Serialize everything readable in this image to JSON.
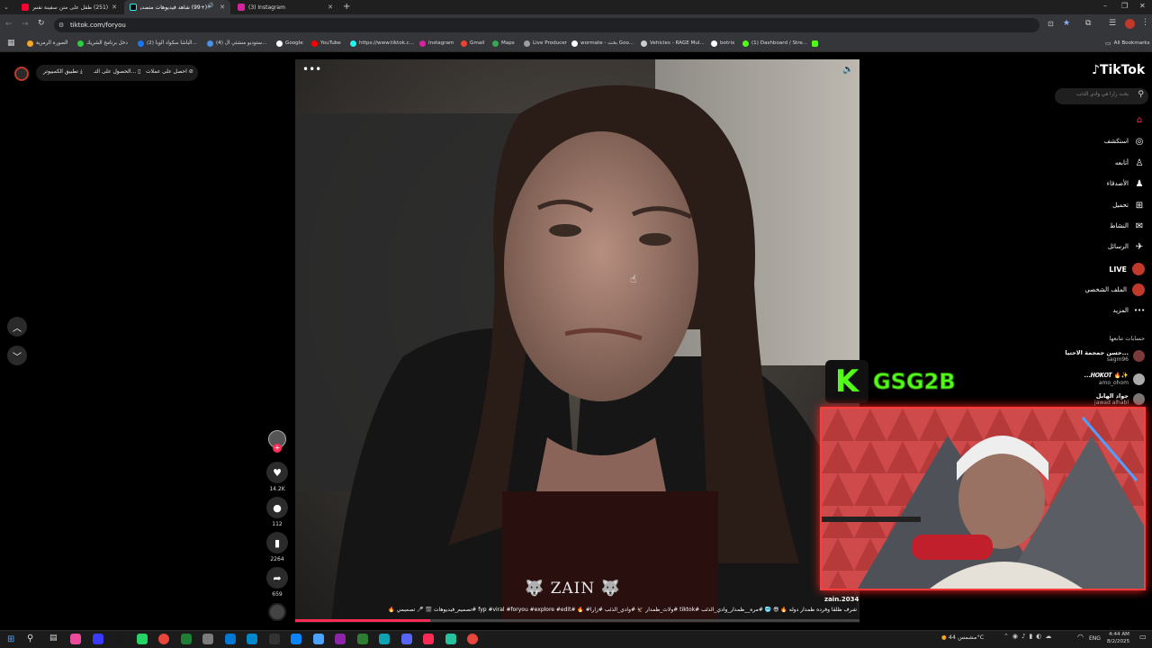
{
  "tabs": [
    {
      "title": "(251) طفل على متن سفينة نفس...",
      "active": false,
      "color": "#ff0033"
    },
    {
      "title": "(+99) شاهد فيديوهات متصدرة...",
      "active": true,
      "color": "#25f4ee"
    },
    {
      "title": "(3) Instagram",
      "active": false,
      "color": "#d6249f"
    }
  ],
  "url": "tiktok.com/foryou",
  "bookmarks": [
    {
      "label": "الصورة الرمزية",
      "color": "#f5a623"
    },
    {
      "label": "دخل برنامج الشريك",
      "color": "#2ecc40"
    },
    {
      "label": "(2) الباشا سكواد الوبا...",
      "color": "#1877f2"
    },
    {
      "label": "(4) ستوديو منشئي ال...",
      "color": "#4a90e2"
    },
    {
      "label": "Google",
      "color": "#ffffff"
    },
    {
      "label": "YouTube",
      "color": "#ff0000"
    },
    {
      "label": "https://www.tiktok.c...",
      "color": "#25f4ee"
    },
    {
      "label": "Instagram",
      "color": "#d6249f"
    },
    {
      "label": "Gmail",
      "color": "#ea4335"
    },
    {
      "label": "Maps",
      "color": "#34a853"
    },
    {
      "label": "Live Producer",
      "color": "#9e9e9e"
    },
    {
      "label": "wormate - بحث Goo...",
      "color": "#ffffff"
    },
    {
      "label": "Vehicles - RAGE Mul...",
      "color": "#cccccc"
    },
    {
      "label": "botrix",
      "color": "#ffffff"
    },
    {
      "label": "(1) Dashboard / Stre...",
      "color": "#53fc18"
    }
  ],
  "all_bookmarks": "All Bookmarks",
  "top_actions": {
    "coins": "احصل على عملات",
    "get_app": "الحصول على التـ...",
    "pc_app": "تطبيق الكمبيوتر"
  },
  "brand": "TikTok",
  "search_placeholder": "بحث زارا في وادي الذئب",
  "sidebar": [
    {
      "label": "",
      "icon": "home-icon",
      "glyph": "⌂"
    },
    {
      "label": "استكشف",
      "icon": "compass-icon",
      "glyph": "◎"
    },
    {
      "label": "أتابعه",
      "icon": "following-icon",
      "glyph": "♙"
    },
    {
      "label": "الأصدقاء",
      "icon": "friends-icon",
      "glyph": "♟"
    },
    {
      "label": "تحميل",
      "icon": "upload-icon",
      "glyph": "⊞"
    },
    {
      "label": "النشاط",
      "icon": "activity-icon",
      "glyph": "✉"
    },
    {
      "label": "الرسائل",
      "icon": "messages-icon",
      "glyph": "✈"
    },
    {
      "label": "LIVE",
      "icon": "live-icon",
      "glyph": "●"
    },
    {
      "label": "الملف الشخصي",
      "icon": "profile-icon",
      "glyph": "●"
    },
    {
      "label": "المزيد",
      "icon": "more-icon",
      "glyph": "•••"
    }
  ],
  "following_title": "حسابات تتابعها",
  "following": [
    {
      "name": "حسن جمجمة الاحتيا...",
      "handle": "sagm96"
    },
    {
      "name": "...𝑯𝑶𝑲𝑶𝑻 🔥✨",
      "handle": "amo_ohom"
    },
    {
      "name": "جواد الهابل",
      "handle": "jawad alhabl"
    }
  ],
  "video": {
    "watermark": "ZAIN",
    "username": "zain.2034",
    "caption": "شرف ظلقا وفرده ظمدار دوله 🔥 😎 🥶 #مره__ظمدار_وادي_الذئب #tiktok #ولاث_ظمدار 🦅 #وادي_الذئب #زارا# 🔥 #fyp #viral #foryou #explore #edit #تصميم_فيديوهات 🎬 🎤 تصميمي 🔥"
  },
  "actions": {
    "likes": "14.2K",
    "comments": "112",
    "saves": "2264",
    "shares": "659"
  },
  "stream_overlay": {
    "logo": "K",
    "name": "GSG2B"
  },
  "tray": {
    "weather": "مشمس 44°C",
    "lang": "ENG",
    "time": "4:44 AM",
    "date": "8/2/2025"
  },
  "colors": {
    "accent": "#fe2c55",
    "kick": "#53fc18",
    "chrome": "#35363a"
  }
}
